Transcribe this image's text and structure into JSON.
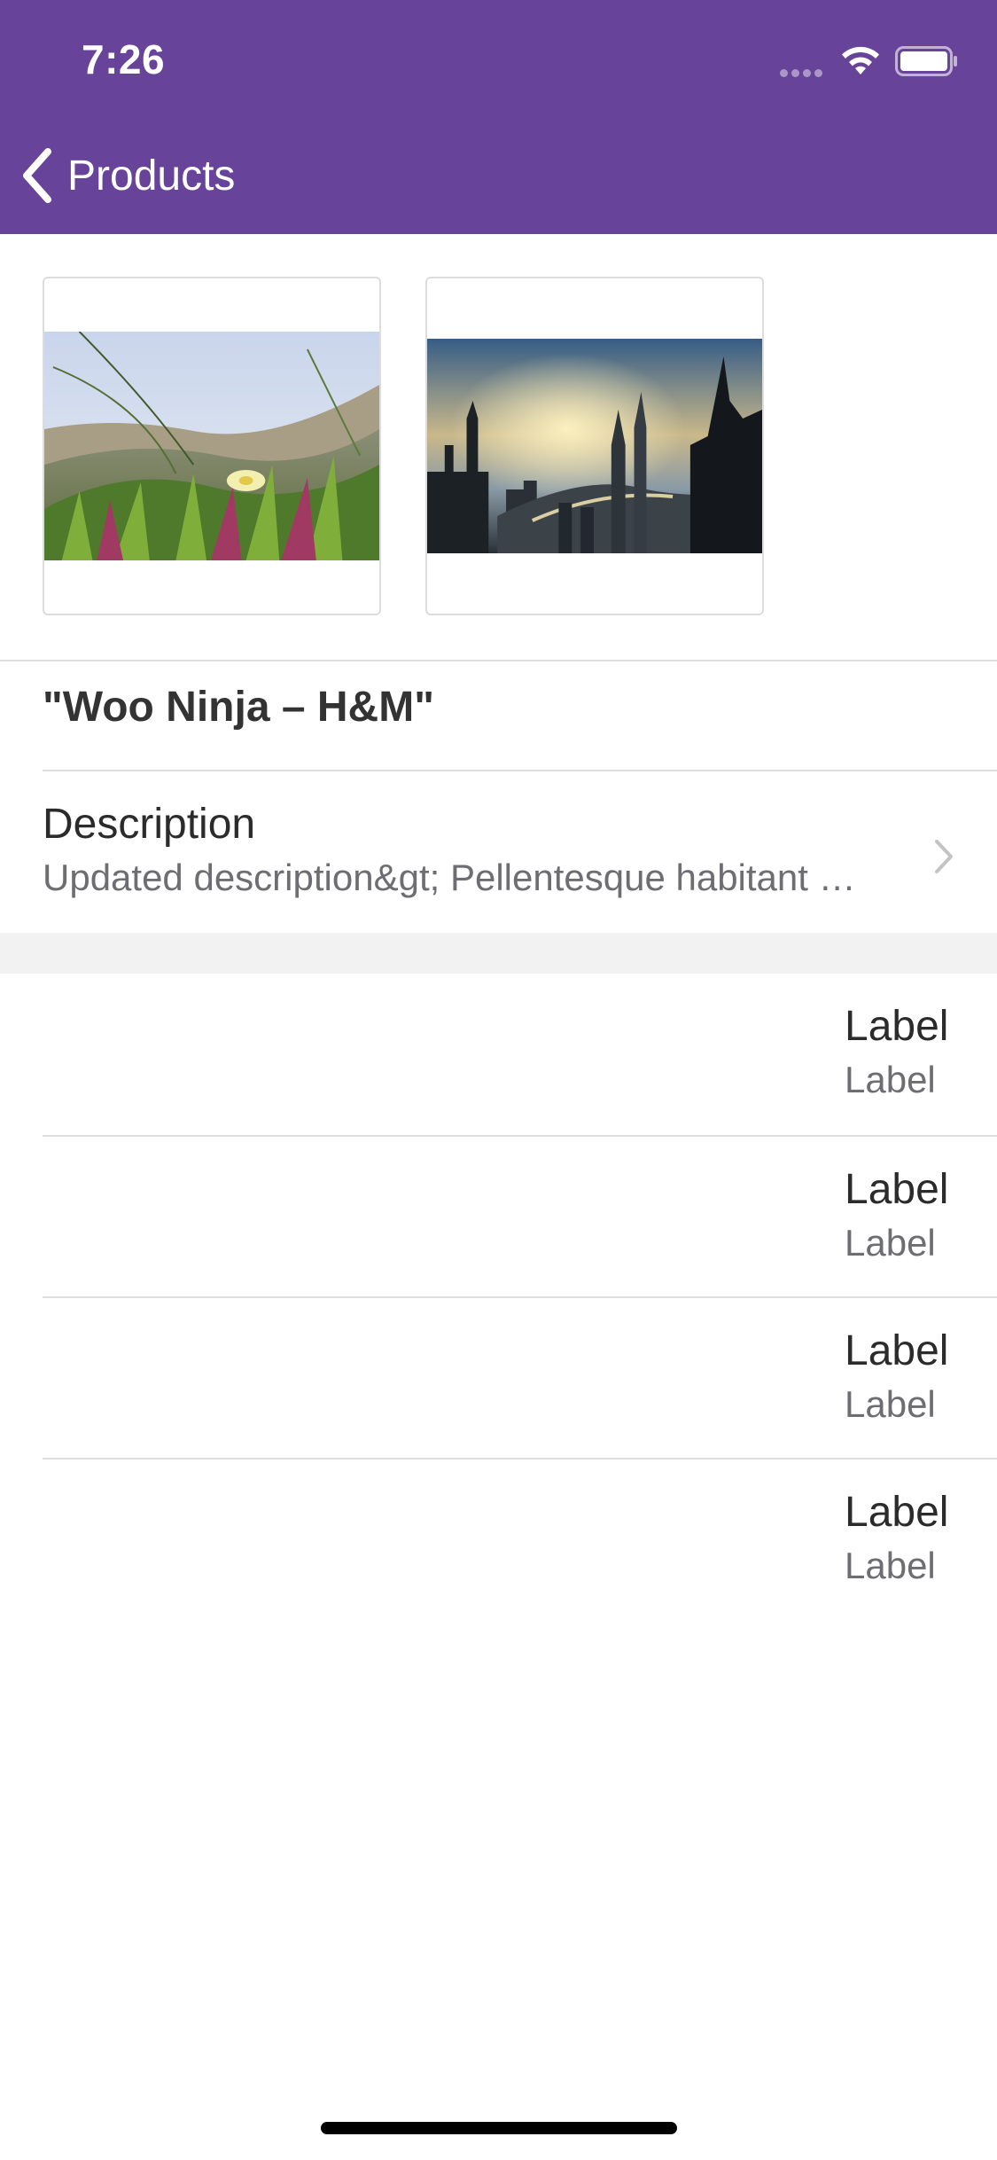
{
  "status_bar": {
    "time": "7:26"
  },
  "nav": {
    "back_label": "Products",
    "back_icon": "chevron-left-icon"
  },
  "images": [
    {
      "name": "dune-grass-flower-image"
    },
    {
      "name": "futuristic-city-image"
    }
  ],
  "product": {
    "title": "\"Woo Ninja – H&M\""
  },
  "description": {
    "label": "Description",
    "text": "Updated description&gt; Pellentesque habitant morbi tristique senectus et netus et malesuada fames ac turpis egestas.",
    "chevron_icon": "chevron-right-icon"
  },
  "rows": [
    {
      "primary": "Label",
      "secondary": "Label"
    },
    {
      "primary": "Label",
      "secondary": "Label"
    },
    {
      "primary": "Label",
      "secondary": "Label"
    },
    {
      "primary": "Label",
      "secondary": "Label"
    }
  ],
  "colors": {
    "header": "#674399",
    "section_gap": "#f3f2f3",
    "secondary_text": "#6d6d72"
  }
}
